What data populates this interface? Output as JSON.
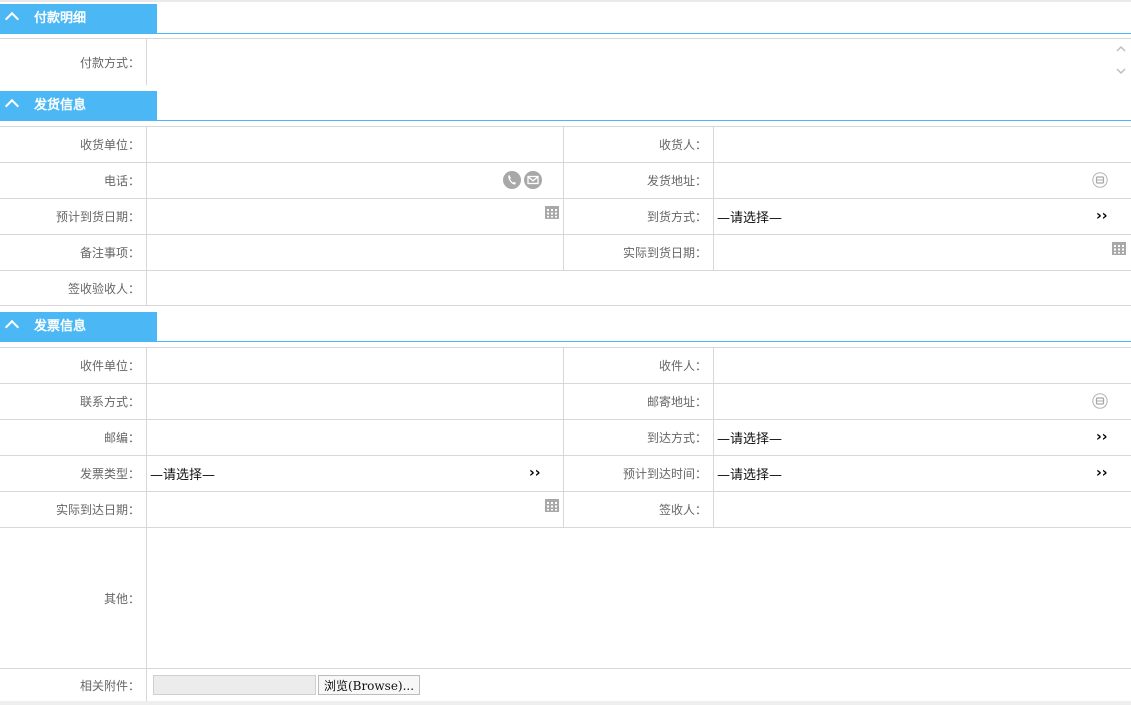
{
  "sections": {
    "payment": {
      "title": "付款明细"
    },
    "shipping": {
      "title": "发货信息"
    },
    "invoice": {
      "title": "发票信息"
    }
  },
  "payment": {
    "method_label": "付款方式：",
    "method_value": ""
  },
  "shipping": {
    "receiver_unit_label": "收货单位：",
    "receiver_label": "收货人：",
    "phone_label": "电话：",
    "ship_address_label": "发货地址：",
    "expected_date_label": "预计到货日期：",
    "arrival_method_label": "到货方式：",
    "arrival_method_value": "—请选择—",
    "remarks_label": "备注事项：",
    "actual_date_label": "实际到货日期：",
    "inspector_label": "签收验收人："
  },
  "invoice": {
    "recipient_unit_label": "收件单位：",
    "recipient_label": "收件人：",
    "contact_label": "联系方式：",
    "mail_address_label": "邮寄地址：",
    "postcode_label": "邮编：",
    "arrival_method_label": "到达方式：",
    "arrival_method_value": "—请选择—",
    "invoice_type_label": "发票类型：",
    "invoice_type_value": "—请选择—",
    "expected_time_label": "预计到达时间：",
    "expected_time_value": "—请选择—",
    "actual_date_label": "实际到达日期：",
    "signer_label": "签收人：",
    "other_label": "其他：",
    "attachment_label": "相关附件：",
    "browse_label": "浏览(Browse)..."
  },
  "icons": {
    "collapse": "chevron-up-icon",
    "calendar": "calendar-icon",
    "phone": "phone-icon",
    "mail": "mail-icon",
    "address": "address-book-icon",
    "select_arrow": "double-chevron-right-icon"
  },
  "colors": {
    "accent": "#4bb8f5",
    "border": "#d7d7d7",
    "label_text": "#666666",
    "icon_gray": "#a8a8a8"
  }
}
